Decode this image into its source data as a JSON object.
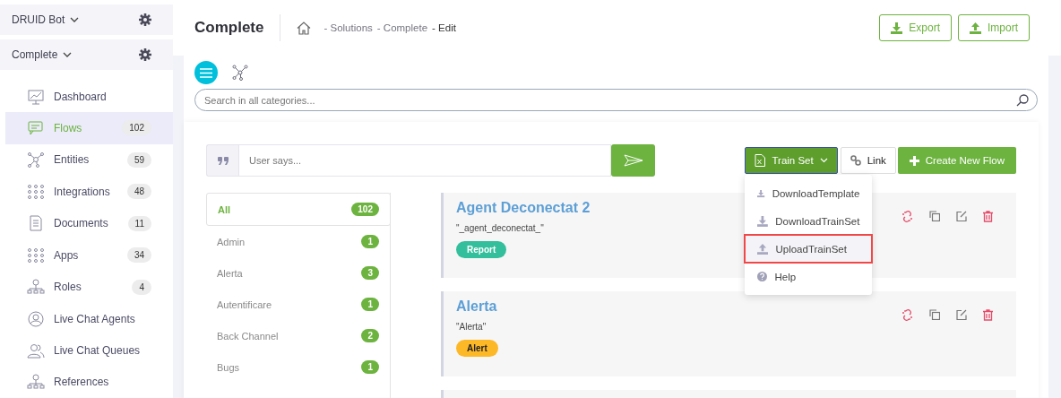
{
  "sidebar": {
    "bot": {
      "label": "DRUID Bot"
    },
    "solution": {
      "label": "Complete"
    },
    "items": [
      {
        "label": "Dashboard",
        "kind": "chart",
        "selected": false
      },
      {
        "label": "Flows",
        "kind": "chat",
        "count": "102",
        "selected": true
      },
      {
        "label": "Entities",
        "kind": "network",
        "count": "59",
        "selected": false
      },
      {
        "label": "Integrations",
        "kind": "dots",
        "count": "48",
        "selected": false
      },
      {
        "label": "Documents",
        "kind": "doc",
        "count": "11",
        "selected": false
      },
      {
        "label": "Apps",
        "kind": "dots",
        "count": "34",
        "selected": false
      },
      {
        "label": "Roles",
        "kind": "org",
        "count": "4",
        "selected": false
      },
      {
        "label": "Live Chat Agents",
        "kind": "person",
        "selected": false
      },
      {
        "label": "Live Chat Queues",
        "kind": "people",
        "selected": false
      },
      {
        "label": "References",
        "kind": "org",
        "selected": false
      }
    ]
  },
  "header": {
    "title": "Complete",
    "breadcrumb": [
      "- Solutions",
      "- Complete",
      "- Edit"
    ],
    "buttons": [
      {
        "label": "Export",
        "kind": "download"
      },
      {
        "label": "Import",
        "kind": "upload"
      }
    ]
  },
  "views": [
    {
      "kind": "list",
      "selected": true
    },
    {
      "kind": "graph",
      "selected": false
    }
  ],
  "search": {
    "placeholder": "Search in all categories..."
  },
  "user_says": {
    "placeholder": "User says..."
  },
  "toolbar": {
    "train_set": "Train Set",
    "link": "Link",
    "create": "Create New Flow"
  },
  "train_menu": [
    {
      "label": "DownloadTemplate",
      "kind": "download",
      "highlighted": false
    },
    {
      "label": "DownloadTrainSet",
      "kind": "download",
      "highlighted": false
    },
    {
      "label": "UploadTrainSet",
      "kind": "upload",
      "highlighted": true
    },
    {
      "label": "Help",
      "kind": "help",
      "highlighted": false
    }
  ],
  "categories": [
    {
      "label": "All",
      "count": "102",
      "selected": true
    },
    {
      "label": "Admin",
      "count": "1",
      "selected": false
    },
    {
      "label": "Alerta",
      "count": "3",
      "selected": false
    },
    {
      "label": "Autentificare",
      "count": "1",
      "selected": false
    },
    {
      "label": "Back Channel",
      "count": "2",
      "selected": false
    },
    {
      "label": "Bugs",
      "count": "1",
      "selected": false
    }
  ],
  "flows": [
    {
      "title": "Agent Deconectat 2",
      "subtitle": "\"_agent_deconectat_\"",
      "tag": "Report",
      "color": "#34bf9c",
      "kind": "full"
    },
    {
      "title": "Alerta",
      "subtitle": "\"Alerta\"",
      "tag": "Alert",
      "color": "#fdb827",
      "kind": "full"
    },
    {
      "kind": "cut-off"
    }
  ]
}
